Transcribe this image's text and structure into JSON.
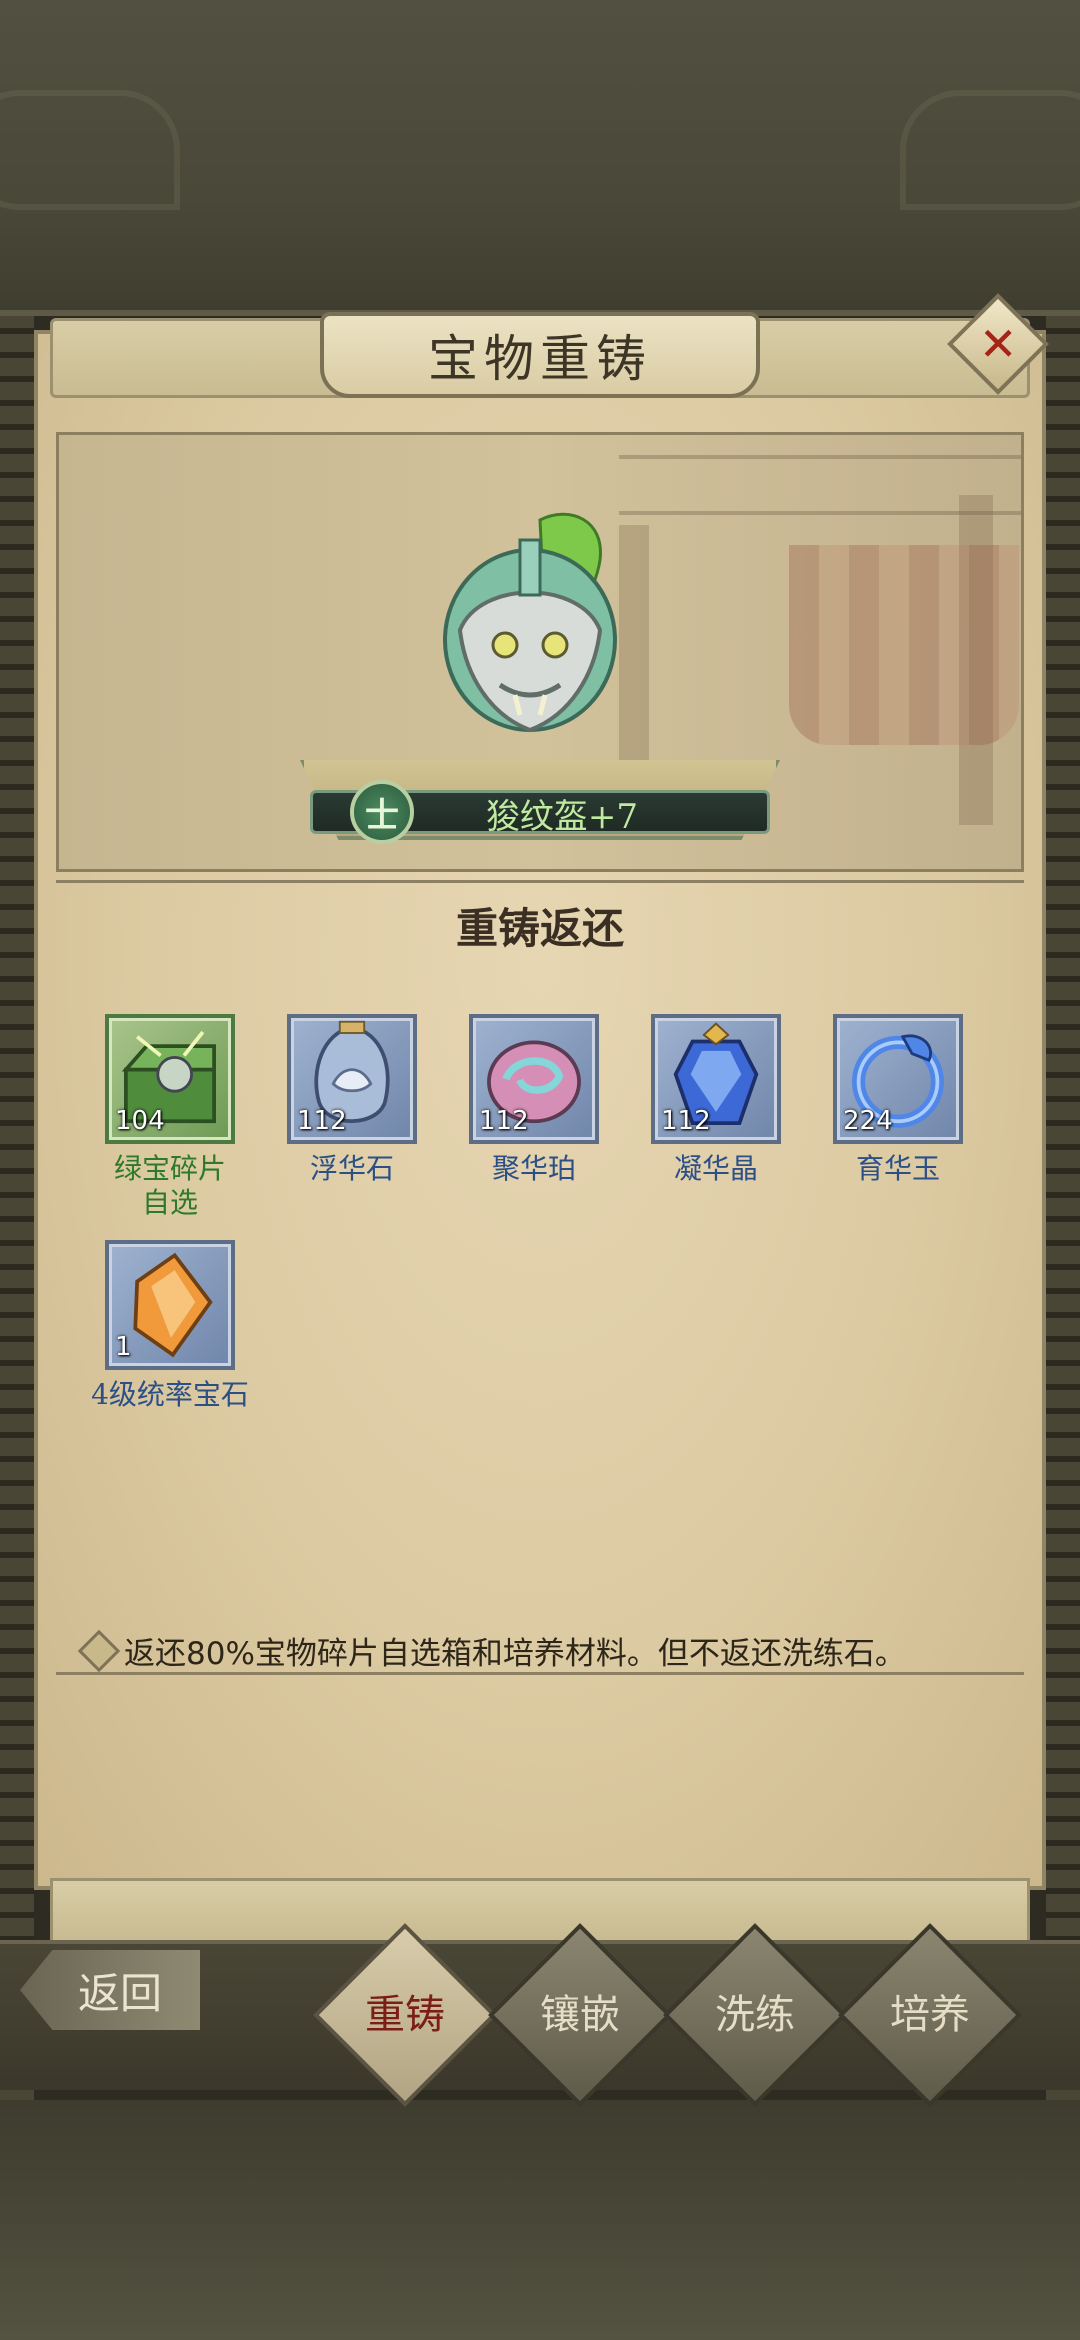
{
  "window": {
    "title": "宝物重铸"
  },
  "treasure": {
    "rank": "士",
    "name": "狻纹盔+7"
  },
  "section": {
    "title": "重铸返还"
  },
  "items": [
    {
      "name": "绿宝碎片\n自选",
      "count": "104",
      "icon": "green-treasure-chest-icon",
      "quality": "green"
    },
    {
      "name": "浮华石",
      "count": "112",
      "icon": "lotus-vase-stone-icon",
      "quality": "blue"
    },
    {
      "name": "聚华珀",
      "count": "112",
      "icon": "swirl-amber-icon",
      "quality": "blue"
    },
    {
      "name": "凝华晶",
      "count": "112",
      "icon": "blue-crystal-icon",
      "quality": "blue"
    },
    {
      "name": "育华玉",
      "count": "224",
      "icon": "dragon-jade-icon",
      "quality": "blue"
    },
    {
      "name": "4级统率宝石",
      "count": "1",
      "icon": "orange-gem-icon",
      "quality": "blue"
    }
  ],
  "note": "返还80%宝物碎片自选箱和培养材料。但不返还洗练石。",
  "nav": {
    "back": "返回",
    "tabs": [
      "重铸",
      "镶嵌",
      "洗练",
      "培养"
    ],
    "active_tab": "重铸"
  },
  "colors": {
    "parchment": "#dccaa2",
    "green_label": "#2e7a2a",
    "blue_label": "#2c4f86",
    "close_x": "#a42518"
  }
}
